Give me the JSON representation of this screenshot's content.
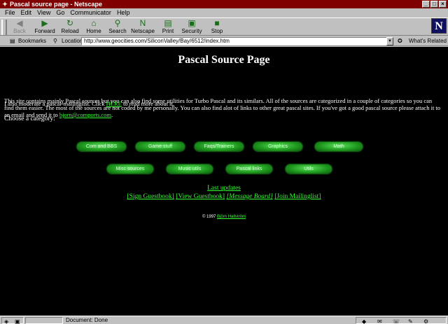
{
  "window": {
    "title": "Pascal source page - Netscape",
    "controls": {
      "minimize": "_",
      "maximize": "□",
      "close": "×"
    }
  },
  "menu": [
    "File",
    "Edit",
    "View",
    "Go",
    "Communicator",
    "Help"
  ],
  "toolbar": {
    "buttons": [
      {
        "label": "Back",
        "icon": "back-arrow-icon",
        "glyph": "◀",
        "enabled": false
      },
      {
        "label": "Forward",
        "icon": "forward-arrow-icon",
        "glyph": "▶",
        "enabled": true
      },
      {
        "label": "Reload",
        "icon": "reload-icon",
        "glyph": "↻",
        "enabled": true
      },
      {
        "label": "Home",
        "icon": "home-icon",
        "glyph": "⌂",
        "enabled": true
      },
      {
        "label": "Search",
        "icon": "search-icon",
        "glyph": "⚲",
        "enabled": true
      },
      {
        "label": "Netscape",
        "icon": "netscape-icon",
        "glyph": "N",
        "enabled": true
      },
      {
        "label": "Print",
        "icon": "print-icon",
        "glyph": "▤",
        "enabled": true
      },
      {
        "label": "Security",
        "icon": "lock-icon",
        "glyph": "▣",
        "enabled": true
      },
      {
        "label": "Stop",
        "icon": "stop-icon",
        "glyph": "■",
        "enabled": true
      }
    ],
    "logo": "N"
  },
  "location": {
    "bookmarks_label": "Bookmarks",
    "location_label": "Location:",
    "url": "http://www.geocities.com/SiliconValley/Bay/6512/index.htm",
    "whats_related": "What's Related"
  },
  "page": {
    "heading": "Pascal Source Page",
    "intro": "This site contains mainly Pascal sources but you can also find some utilities for Turbo Pascal and its similars. All of the sources are categorized in a couple of categories so you can find them easier. The most of the sources are not coded by me personally. You can also find alot of links to other great pascal sites. If you've got a good pascal source please attach it to an email and send it to",
    "email": "bjorn@comports.com",
    "email_end": ".",
    "moderate_before": "I also moderate a pascal-mailinglist. Click",
    "moderate_link": "HERE",
    "moderate_after": "to read more about it.",
    "choose": "Choose a category:",
    "categories_row1": [
      "Com and BBS",
      "Game stuff",
      "Faqs/Trainers",
      "Graphics",
      "Math"
    ],
    "categories_row2": [
      "Misc sources",
      "Music utils",
      "Pascal links",
      "Utils"
    ],
    "last_updates": "Last updates",
    "nav": {
      "sign": "[Sign Guestbook]",
      "view": "[View Guestbook]",
      "board": "[Message Board]",
      "join": "[Join Mailinglist]"
    },
    "copyright_prefix": "© 1997",
    "copyright_author": "Björn Hallström"
  },
  "status": {
    "text": "Document: Done"
  }
}
